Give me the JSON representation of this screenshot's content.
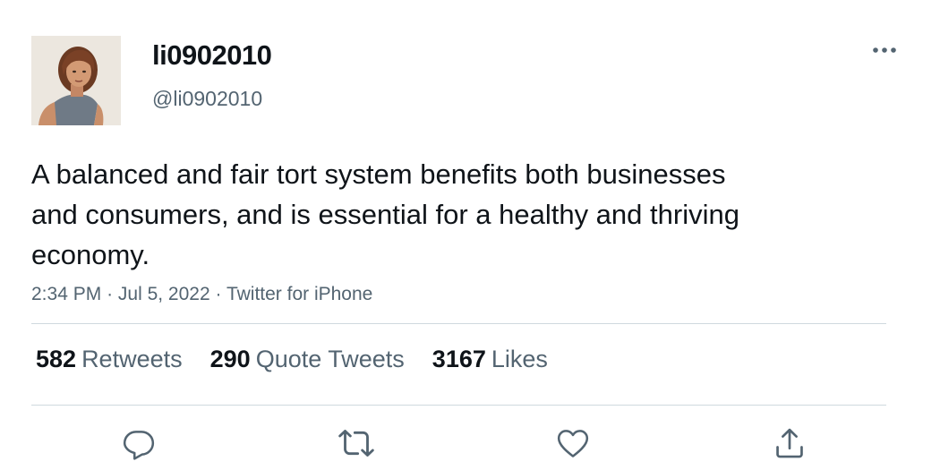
{
  "user": {
    "display_name": "li0902010",
    "handle": "@li0902010"
  },
  "tweet": {
    "text": "A balanced and fair tort system benefits both businesses and consumers, and is essential for a healthy and thriving economy.",
    "time": "2:34 PM",
    "date": "Jul 5, 2022",
    "source": "Twitter for iPhone",
    "separator": "·"
  },
  "stats": {
    "retweets": {
      "count": "582",
      "label": "Retweets"
    },
    "quote_tweets": {
      "count": "290",
      "label": "Quote Tweets"
    },
    "likes": {
      "count": "3167",
      "label": "Likes"
    }
  },
  "icons": {
    "more": "more-horizontal-icon",
    "reply": "reply-icon",
    "retweet": "retweet-icon",
    "like": "heart-icon",
    "share": "share-icon"
  },
  "colors": {
    "text_primary": "#0f1419",
    "text_secondary": "#536471",
    "divider": "#cfd9de"
  }
}
